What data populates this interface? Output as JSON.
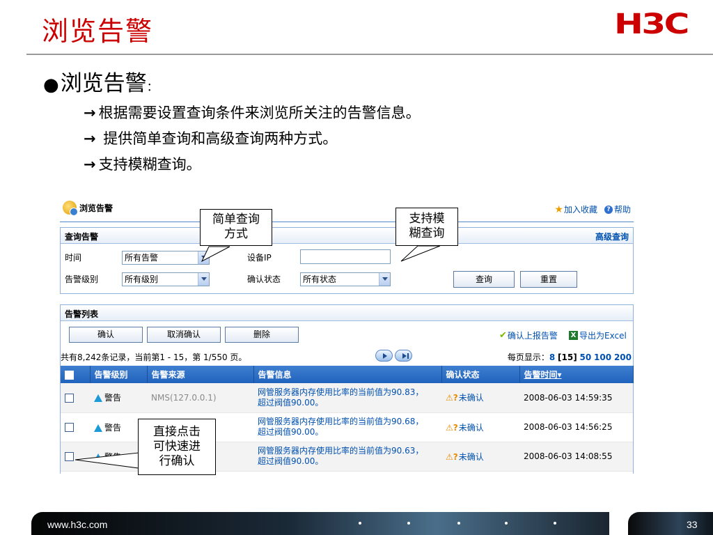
{
  "slide": {
    "title": "浏览告警",
    "logo": "H3C",
    "bullet_dot": "●",
    "bullet_heading": "浏览告警",
    "bullet_colon": "：",
    "point_arrow": "→",
    "points": [
      "根据需要设置查询条件来浏览所关注的告警信息。",
      " 提供简单查询和高级查询两种方式。",
      "支持模糊查询。"
    ]
  },
  "ui": {
    "page_title": "浏览告警",
    "top_links": {
      "favorite": "加入收藏",
      "help": "帮助"
    },
    "query": {
      "header": "查询告警",
      "advanced": "高级查询",
      "time_label": "时间",
      "time_value": "所有告警",
      "ip_label": "设备IP",
      "ip_value": "",
      "severity_label": "告警级别",
      "severity_value": "所有级别",
      "ack_label": "确认状态",
      "ack_value": "所有状态",
      "search_button": "查询",
      "reset_button": "重置"
    },
    "list": {
      "header": "告警列表",
      "ack_button": "确认",
      "unack_button": "取消确认",
      "delete_button": "删除",
      "ack_reported_link": "确认上报告警",
      "export_link": "导出为Excel",
      "record_info": "共有8,242条记录，当前第1 - 15，第  1/550 页。",
      "page_size_label": "每页显示：",
      "page_sizes": [
        "8",
        "[15]",
        "50",
        "100",
        "200"
      ],
      "columns": [
        "告警级别",
        "告警来源",
        "告警信息",
        "确认状态",
        "告警时间"
      ],
      "sort_marker": "▾",
      "rows": [
        {
          "severity": "警告",
          "source": "NMS(127.0.0.1)",
          "info_line1": "网管服务器内存使用比率的当前值为90.83，",
          "info_line2": "超过阀值90.00。",
          "ack": "未确认",
          "time": "2008-06-03 14:59:35"
        },
        {
          "severity": "警告",
          "source": "NMS(127.0.0.1)",
          "info_line1": "网管服务器内存使用比率的当前值为90.68，",
          "info_line2": "超过阀值90.00。",
          "ack": "未确认",
          "time": "2008-06-03 14:56:25"
        },
        {
          "severity": "警告",
          "source": "NMS(127.0.0.1)",
          "info_line1": "网管服务器内存使用比率的当前值为90.63，",
          "info_line2": "超过阀值90.00。",
          "ack": "未确认",
          "time": "2008-06-03 14:08:55"
        }
      ]
    }
  },
  "callouts": {
    "simple_query": [
      "简单查询",
      "方式"
    ],
    "fuzzy_query": [
      "支持模",
      "糊查询"
    ],
    "quick_ack": [
      "直接点击",
      "可快速进",
      "行确认"
    ]
  },
  "footer": {
    "url": "www.h3c.com",
    "page_number": "33"
  },
  "colors": {
    "title_red": "#cc0000",
    "link_blue": "#0050b0",
    "grid_header_blue": "#2f72c8"
  },
  "icons": [
    "alarm-bell-icon",
    "star-icon",
    "help-icon",
    "check-icon",
    "excel-icon",
    "next-page-icon",
    "last-page-icon",
    "warning-severity-icon",
    "unacknowledged-icon"
  ]
}
